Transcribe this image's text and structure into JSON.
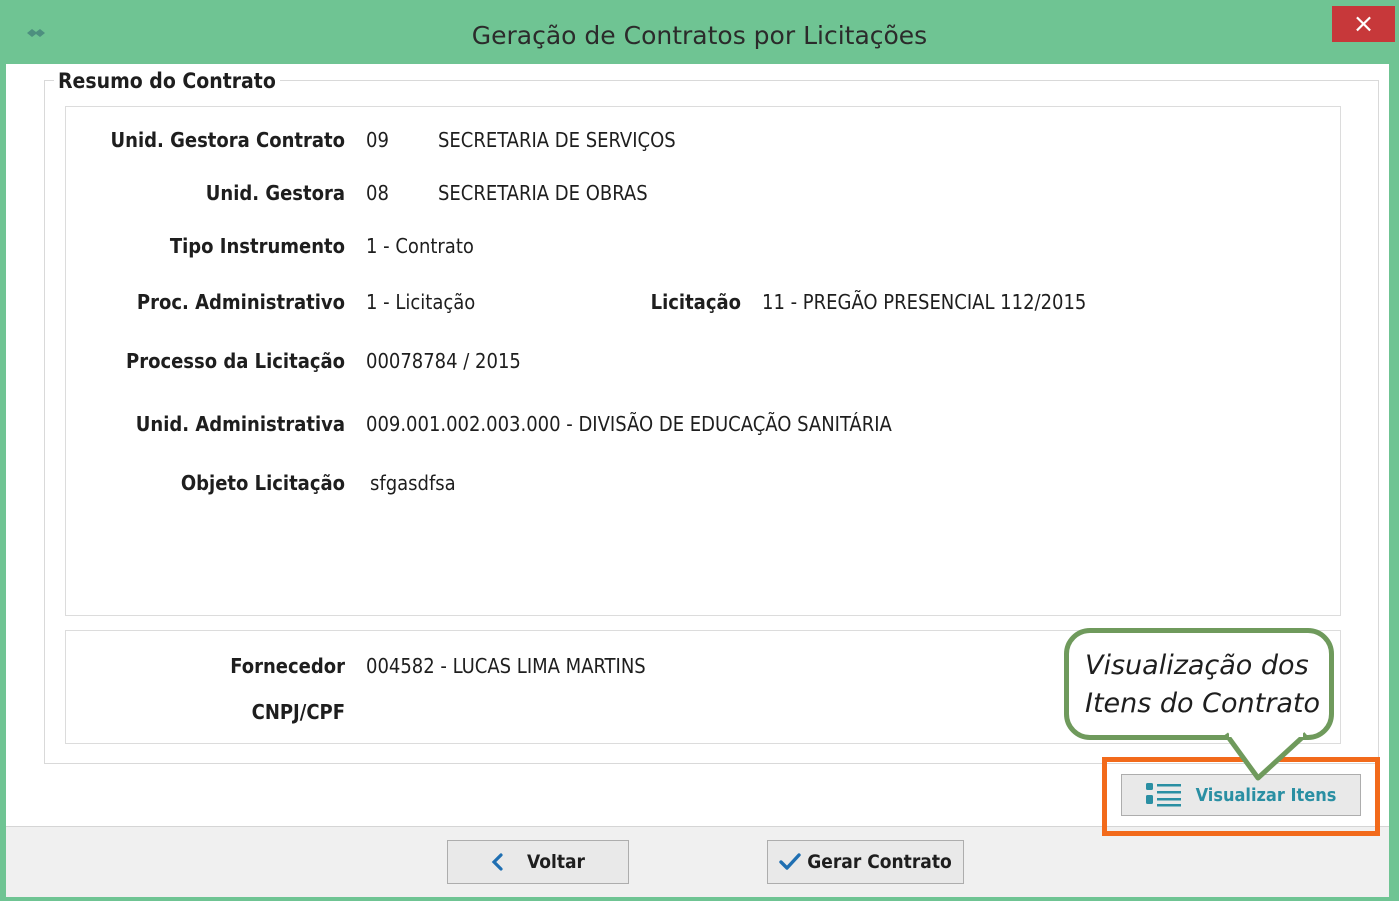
{
  "window": {
    "title": "Geração de Contratos por Licitações",
    "close_label": "×",
    "app_icon": "handshake-icon",
    "title_bar_color": "#6fc493",
    "close_color": "#c7383a"
  },
  "summary": {
    "group_title": "Resumo do Contrato",
    "fields": {
      "unid_gestora_contrato": {
        "label": "Unid. Gestora Contrato",
        "code": "09",
        "name": "SECRETARIA DE SERVIÇOS"
      },
      "unid_gestora": {
        "label": "Unid. Gestora",
        "code": "08",
        "name": "SECRETARIA DE OBRAS"
      },
      "tipo_instrumento": {
        "label": "Tipo Instrumento",
        "value": "1 - Contrato"
      },
      "proc_administrativo": {
        "label": "Proc. Administrativo",
        "value": "1 - Licitação"
      },
      "licitacao": {
        "label": "Licitação",
        "value": "11 - PREGÃO PRESENCIAL 112/2015"
      },
      "processo_licitacao": {
        "label": "Processo da Licitação",
        "value": "00078784 / 2015"
      },
      "unid_administrativa": {
        "label": "Unid. Administrativa",
        "value": "009.001.002.003.000 - DIVISÃO DE EDUCAÇÃO SANITÁRIA"
      },
      "objeto_licitacao": {
        "label": "Objeto Licitação",
        "value": "sfgasdfsa"
      }
    },
    "supplier": {
      "fornecedor_label": "Fornecedor",
      "fornecedor_value": "004582 - LUCAS LIMA MARTINS",
      "cnpj_label": "CNPJ/CPF",
      "cnpj_value": ""
    }
  },
  "callout": {
    "line1": "Visualização dos",
    "line2": "Itens do Contrato",
    "border_color": "#6f9a5c",
    "highlight_color": "#f26a1b"
  },
  "buttons": {
    "visualizar_itens": {
      "label": "Visualizar Itens",
      "icon": "list-icon",
      "color": "#2a8fa3"
    },
    "voltar": {
      "label": "Voltar",
      "icon": "chevron-left-icon"
    },
    "gerar_contrato": {
      "label": "Gerar Contrato",
      "icon": "checkmark-icon"
    }
  }
}
